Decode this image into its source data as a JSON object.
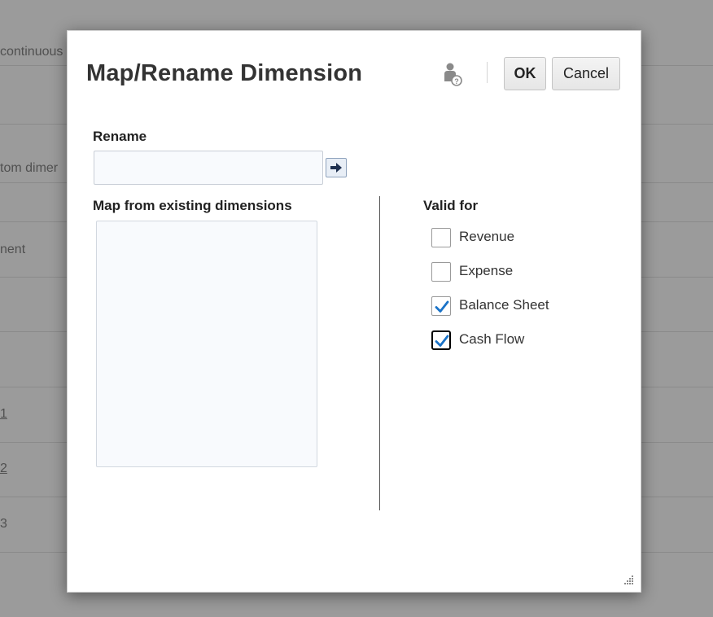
{
  "background": {
    "texts": [
      "continuous",
      "tom dimer",
      "nent",
      "1",
      "2",
      "3"
    ]
  },
  "dialog": {
    "title": "Map/Rename Dimension",
    "help_icon": "user-help-icon",
    "ok_label": "OK",
    "cancel_label": "Cancel",
    "rename_label": "Rename",
    "rename_value": "",
    "rename_go_icon": "arrow-right-icon",
    "map_label": "Map from existing dimensions",
    "map_items": [],
    "valid_for_label": "Valid for",
    "valid_for": [
      {
        "label": "Revenue",
        "checked": false
      },
      {
        "label": "Expense",
        "checked": false
      },
      {
        "label": "Balance Sheet",
        "checked": true
      },
      {
        "label": "Cash Flow",
        "checked": true,
        "focused": true
      }
    ]
  },
  "colors": {
    "checkmark": "#1a73c8",
    "overlay": "#9b9b9b"
  }
}
